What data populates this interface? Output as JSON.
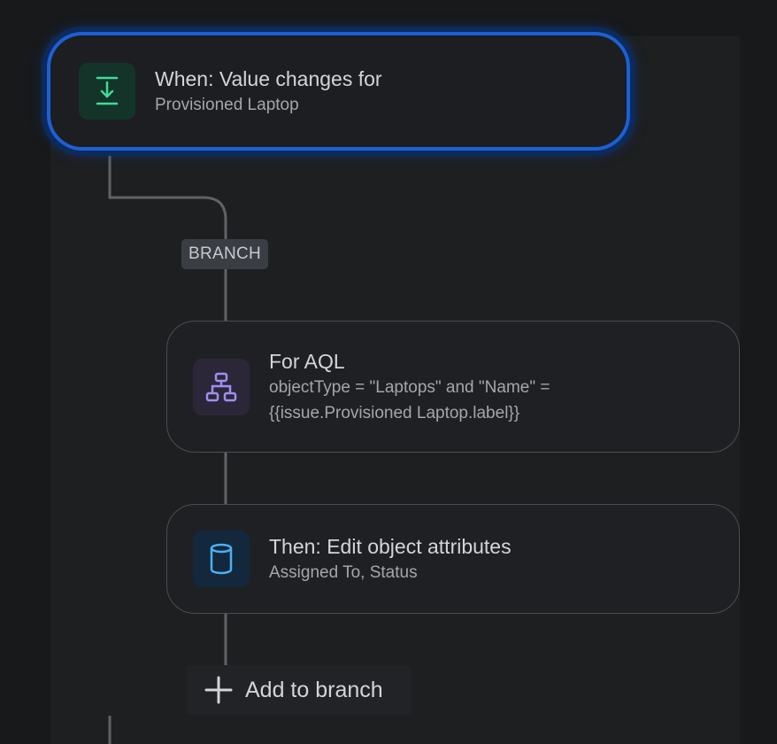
{
  "trigger": {
    "title": "When: Value changes for",
    "subtitle": "Provisioned Laptop",
    "icon": "download-arrow-icon",
    "accent": "#3ddc97"
  },
  "branch": {
    "label": "BRANCH"
  },
  "aql": {
    "title": "For AQL",
    "subtitle": "objectType = \"Laptops\" and \"Name\" = {{issue.Provisioned Laptop.label}}",
    "icon": "hierarchy-icon",
    "accent": "#9f8fef"
  },
  "edit": {
    "title": "Then: Edit object attributes",
    "subtitle": "Assigned To, Status",
    "icon": "database-icon",
    "accent": "#4cb0f5"
  },
  "add_to_branch": {
    "label": "Add to branch",
    "icon": "plus-icon"
  },
  "colors": {
    "selection": "#1c60d6",
    "connector": "#5f6368"
  }
}
